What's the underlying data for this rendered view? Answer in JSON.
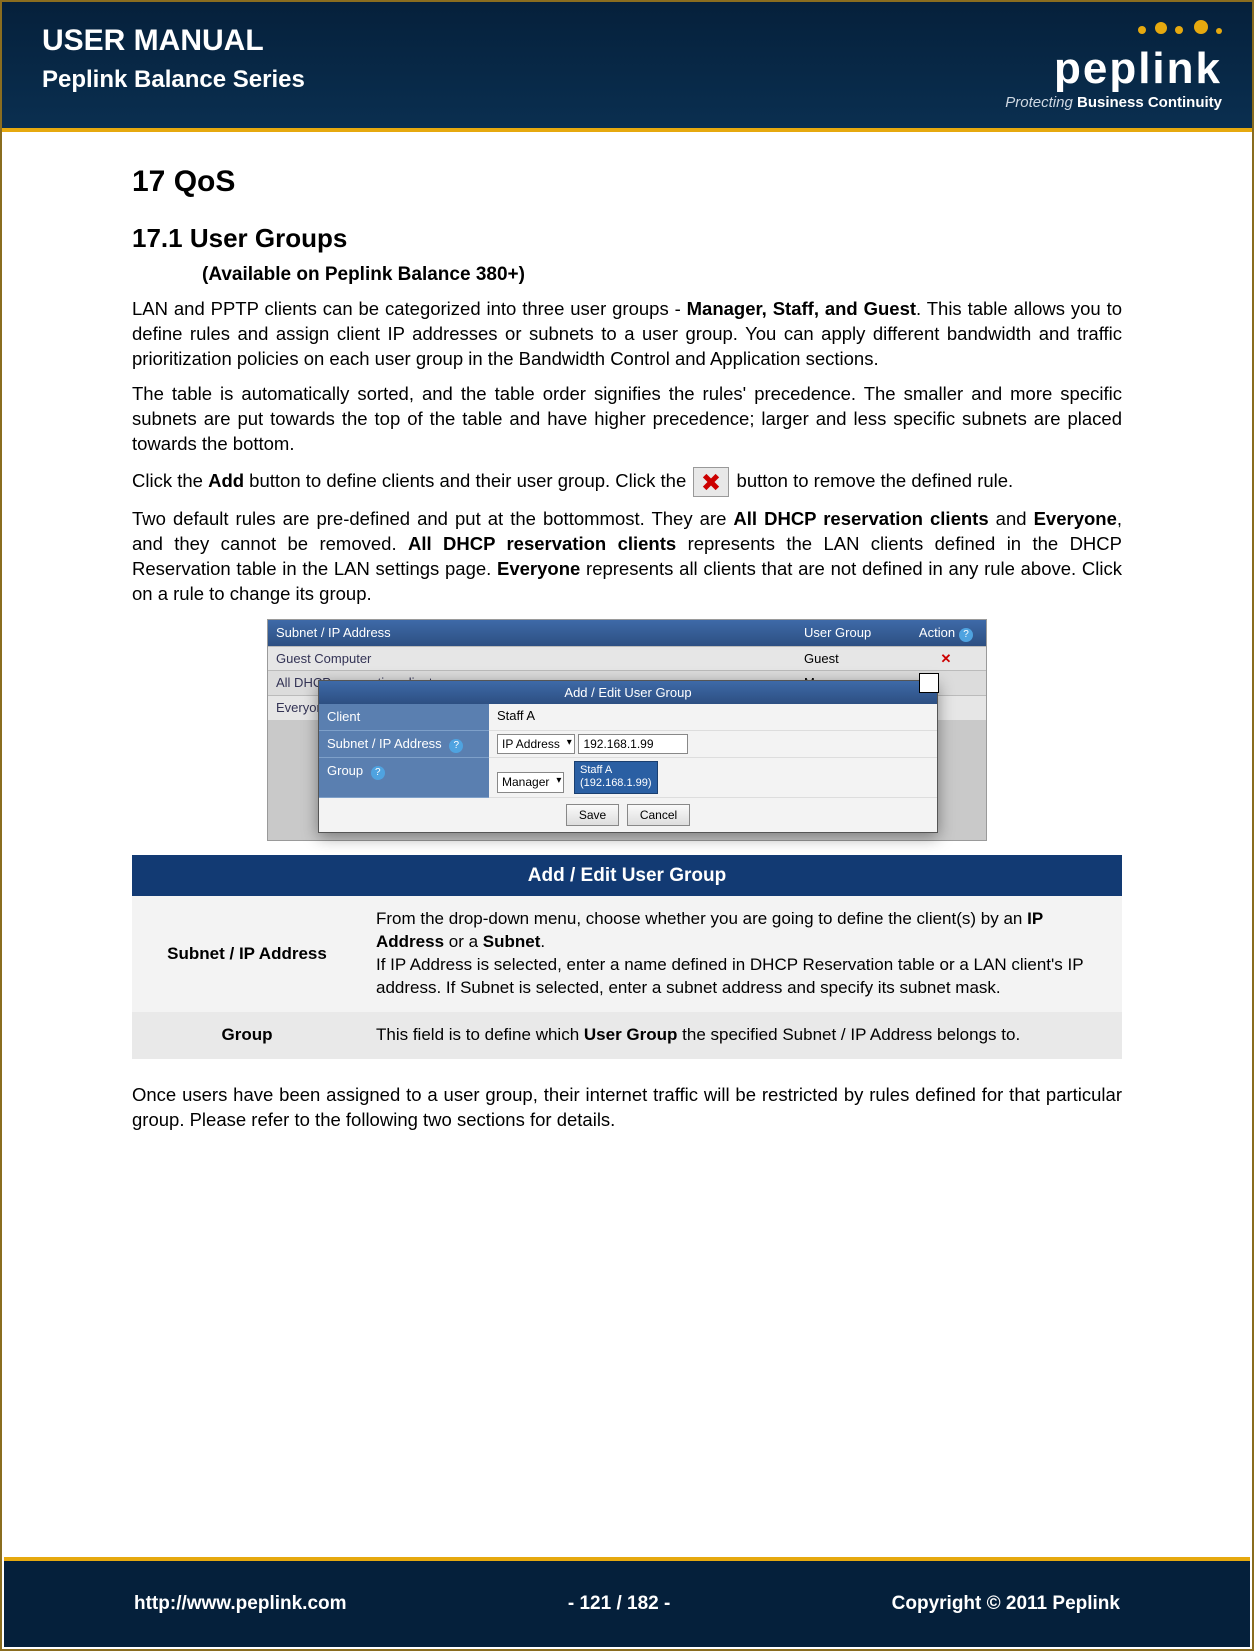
{
  "header": {
    "title": "USER MANUAL",
    "subtitle": "Peplink Balance Series",
    "logo_word": "peplink",
    "logo_tagline_prefix": "Protecting ",
    "logo_tagline_bold": "Business Continuity"
  },
  "section": {
    "num_title": "17   QoS",
    "sub_num_title": "17.1  User Groups",
    "availability": "(Available on Peplink Balance 380+)"
  },
  "para1_a": "LAN and PPTP clients can be categorized into three user groups - ",
  "para1_b_bold": "Manager, Staff, and Guest",
  "para1_c": ".  This table allows you to define rules and assign client IP addresses or subnets to a user group.  You can apply different bandwidth and traffic prioritization policies on each user group in the Bandwidth Control and Application sections.",
  "para2": "The table is automatically sorted, and the table order signifies the rules' precedence.  The smaller and more specific subnets are put towards the top of the table and have higher precedence; larger and less specific subnets are placed towards the bottom.",
  "para3_a": "Click the ",
  "para3_add": "Add",
  "para3_b": " button to define clients and their user group. Click the ",
  "para3_c": " button to remove the defined rule.",
  "para4_a": "Two default rules are pre-defined and put at the bottommost.  They are ",
  "para4_b1": "All DHCP reservation clients",
  "para4_c": " and ",
  "para4_b2": "Everyone",
  "para4_d": ", and they cannot be removed.  ",
  "para4_b3": "All DHCP reservation clients",
  "para4_e": " represents the LAN clients defined in the DHCP Reservation table in the LAN settings page.  ",
  "para4_b4": "Everyone",
  "para4_f": " represents all clients that are not defined in any rule above.  Click on a rule to change its group.",
  "screenshot": {
    "columns": {
      "c1": "Subnet / IP Address",
      "c2": "User Group",
      "c3": "Action"
    },
    "rows": [
      {
        "c1": "Guest Computer",
        "c2": "Guest",
        "c3": "✕"
      },
      {
        "c1": "All DHCP reservation clients",
        "c2": "Manager",
        "c3": ""
      },
      {
        "c1": "Everyone",
        "c2": "",
        "c3": ""
      }
    ],
    "dialog": {
      "title": "Add / Edit User Group",
      "row_client_lbl": "Client",
      "row_client_val": "Staff A",
      "row_subnet_lbl": "Subnet / IP Address",
      "row_subnet_select": "IP Address",
      "row_subnet_input": "192.168.1.99",
      "row_group_lbl": "Group",
      "row_group_select": "Manager",
      "tooltip_line1": "Staff A",
      "tooltip_line2": "(192.168.1.99)",
      "btn_save": "Save",
      "btn_cancel": "Cancel"
    }
  },
  "info_table": {
    "title": "Add / Edit User Group",
    "rows": [
      {
        "label": "Subnet / IP Address",
        "desc_a": "From the drop-down menu, choose whether you are going to define the client(s) by an ",
        "desc_b1": "IP Address",
        "desc_c": " or a ",
        "desc_b2": "Subnet",
        "desc_d": ".",
        "desc_line2": "If IP Address is selected, enter a name defined in DHCP Reservation table or a LAN client's IP address.  If Subnet is selected, enter a subnet address and specify its subnet mask."
      },
      {
        "label": "Group",
        "desc_a": "This field is to define which ",
        "desc_b1": "User Group",
        "desc_c": " the specified Subnet / IP Address belongs to."
      }
    ]
  },
  "para5": "Once users have been assigned to a user group, their internet traffic will be restricted by rules defined for that particular group. Please refer to the following two sections for details.",
  "footer": {
    "url": "http://www.peplink.com",
    "page": "- 121 / 182 -",
    "copyright": "Copyright © 2011 Peplink"
  }
}
